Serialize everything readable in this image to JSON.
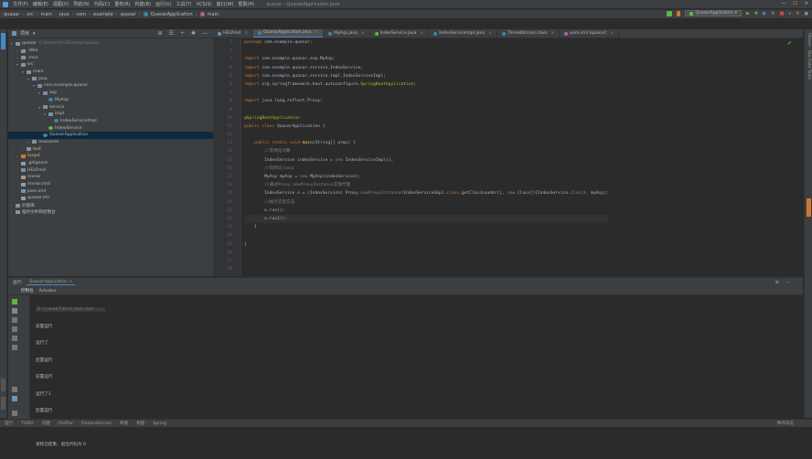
{
  "menubar": {
    "items": [
      "文件(F)",
      "编辑(E)",
      "视图(V)",
      "导航(N)",
      "代码(C)",
      "重构(R)",
      "构建(B)",
      "运行(U)",
      "工具(T)",
      "VCS(S)",
      "窗口(W)",
      "帮助(H)"
    ],
    "window_title": "quasar - QuasarApplication.java",
    "min_icon": "—",
    "max_icon": "☐",
    "close_icon": "✕"
  },
  "breadcrumb": [
    "quasar",
    "src",
    "main",
    "java",
    "com",
    "example",
    "quasar",
    "QuasarApplication",
    "main"
  ],
  "toolbar": {
    "run_config": "QuasarApplication",
    "dropdown_icon": "▾"
  },
  "project": {
    "title": "项目",
    "tools": [
      "⊕",
      "☰",
      "÷",
      "✱",
      "—"
    ],
    "tree": [
      {
        "label": "quasar",
        "path": "C:\\Users\\xfn\\Desktop\\quasar",
        "depth": 0,
        "icon": "fold",
        "arrow": "▾"
      },
      {
        "label": ".idea",
        "depth": 1,
        "icon": "fold",
        "arrow": "›"
      },
      {
        "label": ".mvn",
        "depth": 1,
        "icon": "fold",
        "arrow": "›"
      },
      {
        "label": "src",
        "depth": 1,
        "icon": "fold",
        "arrow": "▾"
      },
      {
        "label": "main",
        "depth": 2,
        "icon": "fold",
        "arrow": "▾"
      },
      {
        "label": "java",
        "depth": 3,
        "icon": "fold",
        "arrow": "▾"
      },
      {
        "label": "com.example.quasar",
        "depth": 4,
        "icon": "pkg",
        "arrow": "▾"
      },
      {
        "label": "asp",
        "depth": 5,
        "icon": "pkg",
        "arrow": "▾"
      },
      {
        "label": "MyAsp",
        "depth": 6,
        "icon": "cls",
        "arrow": ""
      },
      {
        "label": "service",
        "depth": 5,
        "icon": "pkg",
        "arrow": "▾"
      },
      {
        "label": "impl",
        "depth": 6,
        "icon": "pkg",
        "arrow": "▾"
      },
      {
        "label": "IndexServiceImpl",
        "depth": 7,
        "icon": "cls",
        "arrow": ""
      },
      {
        "label": "IndexService",
        "depth": 6,
        "icon": "iface",
        "arrow": ""
      },
      {
        "label": "QuasarApplication",
        "depth": 5,
        "icon": "cls",
        "arrow": "",
        "selected": true
      },
      {
        "label": "resources",
        "depth": 3,
        "icon": "fold",
        "arrow": "›"
      },
      {
        "label": "test",
        "depth": 2,
        "icon": "fold",
        "arrow": "›"
      },
      {
        "label": "target",
        "depth": 1,
        "icon": "xml",
        "arrow": "›",
        "target": true
      },
      {
        "label": ".gitignore",
        "depth": 1,
        "icon": "txt",
        "arrow": ""
      },
      {
        "label": "HELP.md",
        "depth": 1,
        "icon": "md",
        "arrow": ""
      },
      {
        "label": "mvnw",
        "depth": 1,
        "icon": "txt",
        "arrow": ""
      },
      {
        "label": "mvnw.cmd",
        "depth": 1,
        "icon": "txt",
        "arrow": ""
      },
      {
        "label": "pom.xml",
        "depth": 1,
        "icon": "md",
        "arrow": ""
      },
      {
        "label": "quasar.iml",
        "depth": 1,
        "icon": "txt",
        "arrow": ""
      },
      {
        "label": "外部库",
        "depth": 0,
        "icon": "fold",
        "arrow": "›"
      },
      {
        "label": "临时文件和控制台",
        "depth": 0,
        "icon": "fold",
        "arrow": "›"
      }
    ]
  },
  "tabs": [
    {
      "label": "HELP.md",
      "active": false
    },
    {
      "label": "QuasarApplication.java",
      "active": true
    },
    {
      "label": "MyAsp.java",
      "active": false
    },
    {
      "label": "IndexService.java",
      "active": false
    },
    {
      "label": "IndexServiceImpl.java",
      "active": false
    },
    {
      "label": "ThreadAccess.class",
      "active": false
    },
    {
      "label": "pom.xml (quasar)",
      "active": false
    }
  ],
  "editor": {
    "line_numbers": [
      "1",
      "2",
      "3",
      "4",
      "5",
      "6",
      "7",
      "8",
      "9",
      "10",
      "11",
      "12",
      "13",
      "14",
      "15",
      "16",
      "17",
      "18",
      "19",
      "20",
      "21",
      "22",
      "23",
      "24",
      "25",
      "26",
      "27",
      "28"
    ],
    "lines": [
      [
        [
          "kw",
          "package "
        ],
        [
          "pl",
          "com.example.quasar;"
        ]
      ],
      [],
      [
        [
          "kw",
          "import "
        ],
        [
          "imp",
          "com.example.quasar.asp.MyAsp;"
        ]
      ],
      [
        [
          "kw",
          "import "
        ],
        [
          "imp",
          "com.example.quasar.service.IndexService;"
        ]
      ],
      [
        [
          "kw",
          "import "
        ],
        [
          "imp",
          "com.example.quasar.service.impl.IndexServiceImpl;"
        ]
      ],
      [
        [
          "kw",
          "import "
        ],
        [
          "imp",
          "org.springframework.boot.autoconfigure."
        ],
        [
          "ann",
          "SpringBootApplication"
        ],
        [
          "pl",
          ";"
        ]
      ],
      [],
      [
        [
          "kw",
          "import "
        ],
        [
          "imp",
          "java.lang.reflect.Proxy;"
        ]
      ],
      [],
      [
        [
          "ann",
          "@SpringBootApplication"
        ]
      ],
      [
        [
          "kw",
          "public class "
        ],
        [
          "pl",
          "QuasarApplication {"
        ]
      ],
      [],
      [
        [
          "pl",
          "    "
        ],
        [
          "kw",
          "public static void "
        ],
        [
          "fn",
          "main"
        ],
        [
          "pl",
          "(String[] args) {"
        ]
      ],
      [
        [
          "cm",
          "        //实例化对象"
        ]
      ],
      [
        [
          "pl",
          "        IndexService indexService = "
        ],
        [
          "kw",
          "new "
        ],
        [
          "pl",
          "IndexServiceImpl();"
        ]
      ],
      [
        [
          "cm",
          "        //得到切入asp"
        ]
      ],
      [
        [
          "pl",
          "        MyAsp myAsp = "
        ],
        [
          "kw",
          "new "
        ],
        [
          "pl",
          "MyAsp(indexService);"
        ]
      ],
      [
        [
          "cm",
          "        //通过Proxy.newProxyInstance实现代理"
        ]
      ],
      [
        [
          "pl",
          "        IndexService o = (IndexService) Proxy."
        ],
        [
          "it",
          "newProxyInstance"
        ],
        [
          "pl",
          "(IndexServiceImpl."
        ],
        [
          "kw",
          "class"
        ],
        [
          "pl",
          ".getClassLoader(), "
        ],
        [
          "kw",
          "new "
        ],
        [
          "pl",
          "Class[]{IndexService."
        ],
        [
          "kw",
          "class"
        ],
        [
          "pl",
          "}, myAsp);"
        ]
      ],
      [
        [
          "cm",
          "        //执行实现方法"
        ]
      ],
      [
        [
          "pl",
          "        o.run();"
        ]
      ],
      [
        [
          "pl",
          "        o.run1();"
        ]
      ],
      [
        [
          "pl",
          "    }"
        ]
      ],
      [],
      [
        [
          "pl",
          "}"
        ]
      ],
      [],
      [],
      []
    ]
  },
  "run": {
    "label": "运行:",
    "tab": "QuasarApplication",
    "subtabs": [
      "控制台",
      "Actuator"
    ],
    "console": {
      "cmd": "D:\\java17\\bin\\java.exe ...",
      "lines": [
        "前置运行",
        "运行了",
        "后置运行",
        "前置运行",
        "运行了1",
        "后置运行",
        "",
        "进程已结束，退出代码为 0"
      ]
    }
  },
  "statusbar": {
    "items": [
      "运行",
      "TODO",
      "问题",
      "Profiler",
      "Dependencies",
      "终端",
      "构建",
      "Spring"
    ],
    "right": "事件日志"
  },
  "rightstrip": [
    "Maven",
    "Big Data Tools"
  ]
}
